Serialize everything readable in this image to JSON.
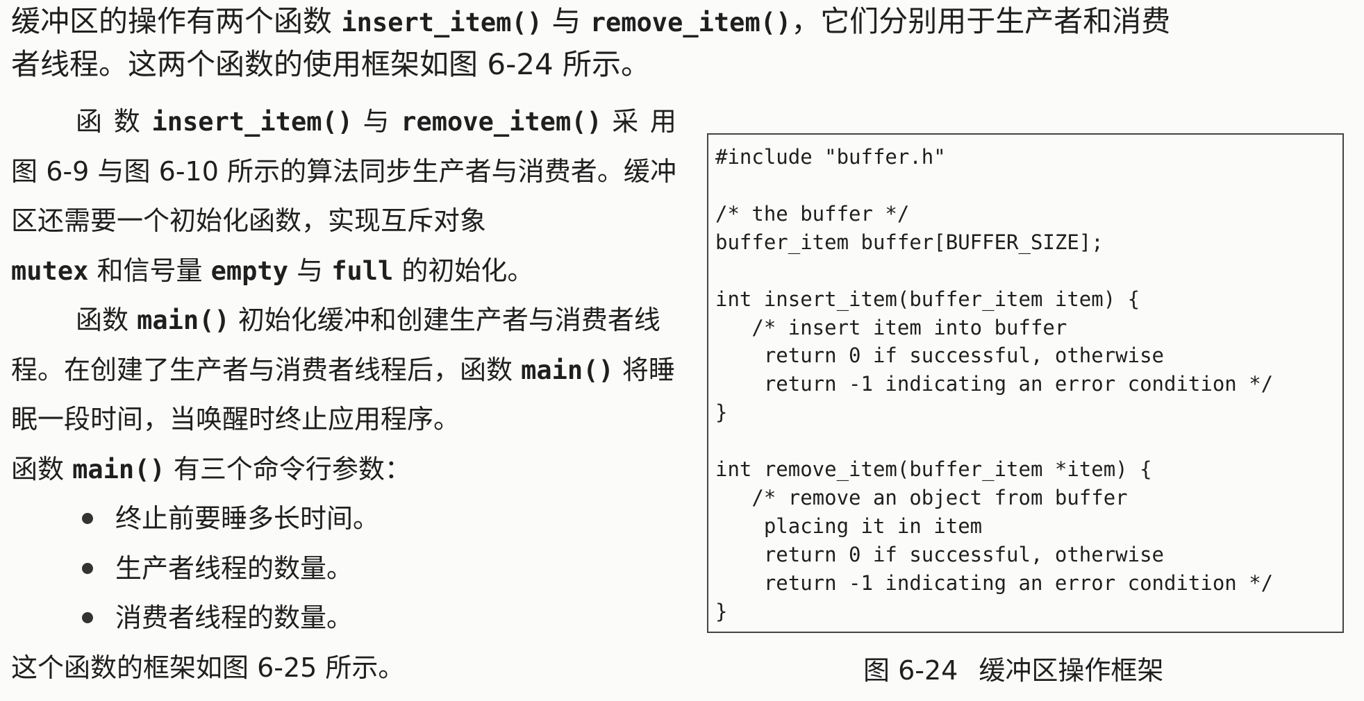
{
  "top": {
    "l1a": "缓冲区的操作有两个函数",
    "l1b": "insert_item()",
    "l1c": "与",
    "l1d": "remove_item()",
    "l1e": "，它们分别用于生产者和消费",
    "l2": "者线程。这两个函数的使用框架如图 6-24 所示。"
  },
  "body": {
    "p1a": "函 数",
    "p1b": "insert_item()",
    "p1c": "与",
    "p1d": "remove_item()",
    "p1e": "采 用图 6-9 与图 6-10 所示的算法同步生产者与消费者。缓冲区还需要一个初始化函数，实现互斥对象",
    "p1f": "mutex",
    "p1g": "和信号量",
    "p1h": "empty",
    "p1i": "与",
    "p1j": "full",
    "p1k": "的初始化。",
    "p2a": "函数",
    "p2b": "main()",
    "p2c": "初始化缓冲和创建生产者与消费者线程。在创建了生产者与消费者线程后，函数",
    "p2d": "main()",
    "p2e": "将睡眠一段时间，当唤醒时终止应用程序。",
    "p3a": "函数",
    "p3b": "main()",
    "p3c": "有三个命令行参数：",
    "bullets": [
      "终止前要睡多长时间。",
      "生产者线程的数量。",
      "消费者线程的数量。"
    ],
    "last": "这个函数的框架如图 6-25 所示。"
  },
  "code": {
    "lines": [
      "#include \"buffer.h\"",
      "/* the buffer */",
      "buffer_item buffer[BUFFER_SIZE];",
      "int insert_item(buffer_item item) {",
      "   /* insert item into buffer",
      "    return 0 if successful, otherwise",
      "    return -1 indicating an error condition */",
      "}",
      "int remove_item(buffer_item *item) {",
      "   /* remove an object from buffer",
      "    placing it in item",
      "    return 0 if successful, otherwise",
      "    return -1 indicating an error condition */",
      "}"
    ]
  },
  "caption": {
    "number": "图 6-24",
    "title": "缓冲区操作框架"
  }
}
